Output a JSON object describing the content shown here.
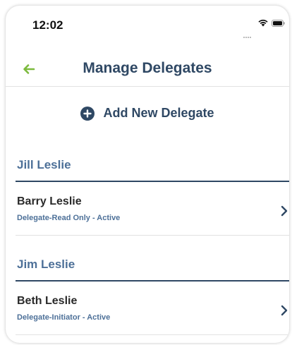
{
  "status_bar": {
    "time": "12:02"
  },
  "nav": {
    "title": "Manage Delegates"
  },
  "add_button": {
    "label": "Add New Delegate"
  },
  "groups": [
    {
      "owner": "Jill Leslie",
      "delegates": [
        {
          "name": "Barry Leslie",
          "status": "Delegate-Read Only - Active"
        }
      ]
    },
    {
      "owner": "Jim Leslie",
      "delegates": [
        {
          "name": "Beth Leslie",
          "status": "Delegate-Initiator - Active"
        }
      ]
    }
  ],
  "colors": {
    "back_arrow": "#7cba3d",
    "title": "#2f4864",
    "group_header": "#4d7098",
    "divider": "#2f4864"
  },
  "icons": [
    "back-arrow-icon",
    "plus-circle-icon",
    "chevron-right-icon",
    "wifi-icon",
    "battery-icon",
    "signal-icon"
  ]
}
